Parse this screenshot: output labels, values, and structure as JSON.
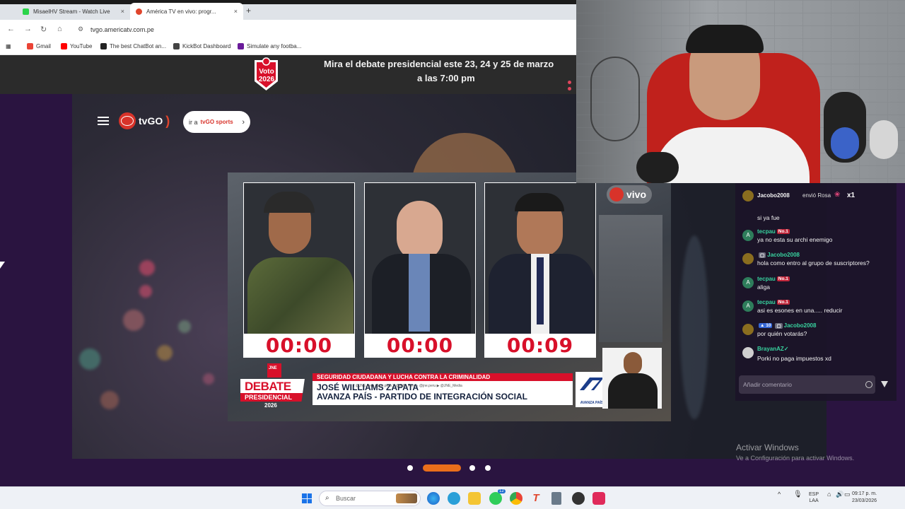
{
  "browser": {
    "tabs": [
      {
        "title": "MisaelHV Stream - Watch Live"
      },
      {
        "title": "América TV en vivo: progr..."
      }
    ],
    "url": "tvgo.americatv.com.pe",
    "bookmarks": [
      {
        "label": "Gmail",
        "color": "#ea4335"
      },
      {
        "label": "YouTube",
        "color": "#ff0000"
      },
      {
        "label": "The best ChatBot an...",
        "color": "#222222"
      },
      {
        "label": "KickBot Dashboard",
        "color": "#444444"
      },
      {
        "label": "Simulate any footba...",
        "color": "#6a1b9a"
      }
    ]
  },
  "banner": {
    "logo_text": "Voto 2026",
    "line1": "Mira el debate presidencial este 23, 24 y 25 de marzo",
    "line2": "a las 7:00 pm"
  },
  "site": {
    "brand": "tvGO",
    "sports_prefix": "ir a",
    "sports_label": "tvGO sports"
  },
  "player": {
    "live_label": "vivo",
    "candidates": [
      {
        "timer": "00:00"
      },
      {
        "timer": "00:00"
      },
      {
        "timer": "00:09"
      }
    ],
    "lower_third": {
      "logo_top": "JNE",
      "logo_main": "DEBATE",
      "logo_sub": "PRESIDENCIAL",
      "logo_year": "2026",
      "topic": "SEGURIDAD CIUDADANA Y LUCHA CONTRA LA CRIMINALIDAD",
      "name": "JOSÉ WILLIAMS ZAPATA",
      "party": "AVANZA PAÍS - PARTIDO DE INTEGRACIÓN SOCIAL",
      "socials": "f @JNE.Peru    @jne.peru    X @JNE_Peru    ♪ @jne.peru    ▶ @JNE_Media",
      "party_logo_label": "AVANZA PAÍS"
    }
  },
  "chat": {
    "gift": {
      "user": "Jacobo2008",
      "text": "envió Rosa",
      "count": "x1"
    },
    "messages": [
      {
        "user": "",
        "badges": [],
        "text": "si ya fue",
        "color": "#f2f2f2",
        "avatar": "#8a6d1f"
      },
      {
        "user": "tecpau",
        "badges": [
          "No.1"
        ],
        "text": "ya no esta su archi enemigo",
        "color": "#38d39f",
        "avatar": "#2e7d5b"
      },
      {
        "user": "Jacobo2008",
        "badges": [
          ""
        ],
        "text": "hola como entro al grupo de suscriptores?",
        "color": "#38d39f",
        "avatar": "#8a6d1f"
      },
      {
        "user": "tecpau",
        "badges": [
          "No.1"
        ],
        "text": "aliga",
        "color": "#38d39f",
        "avatar": "#2e7d5b"
      },
      {
        "user": "tecpau",
        "badges": [
          "No.1"
        ],
        "text": "asi es esones en una..... reducir",
        "color": "#38d39f",
        "avatar": "#2e7d5b"
      },
      {
        "user": "Jacobo2008",
        "badges": [
          "10",
          ""
        ],
        "text": "por quién votarás?",
        "color": "#38d39f",
        "avatar": "#8a6d1f"
      },
      {
        "user": "BrayanAZ✓",
        "badges": [],
        "text": "Porki no paga impuestos xd",
        "color": "#38d39f",
        "avatar": "#cfcfcf"
      }
    ],
    "input_placeholder": "Añadir comentario"
  },
  "activation": {
    "title": "Activar Windows",
    "subtitle": "Ve a Configuración para activar Windows."
  },
  "taskbar": {
    "search_label": "Buscar",
    "lang_top": "ESP",
    "lang_bottom": "LAA",
    "time": "09:17 p. m.",
    "date": "23/03/2026",
    "whatsapp_badge": "12"
  }
}
